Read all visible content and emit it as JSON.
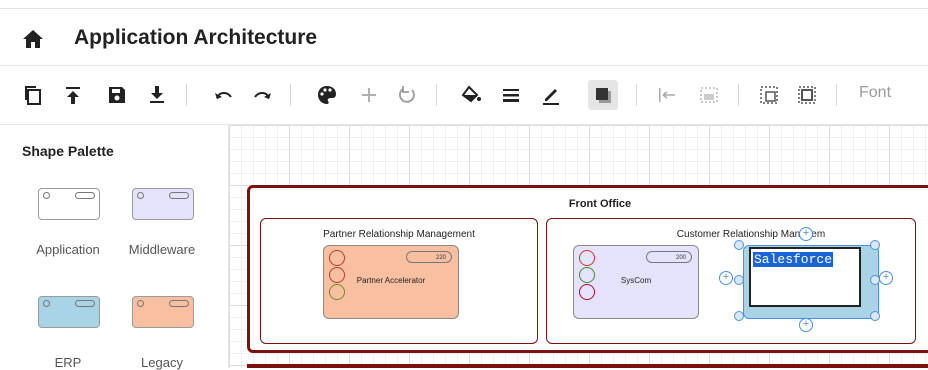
{
  "header": {
    "title": "Application Architecture"
  },
  "toolbar": {
    "font_label": "Font",
    "buttons": [
      "copy-icon",
      "bring-front-icon",
      "save-icon",
      "download-icon",
      "undo-icon",
      "redo-icon",
      "palette-icon",
      "add-icon",
      "reset-icon",
      "fill-icon",
      "line-style-icon",
      "pen-icon",
      "shadow-icon",
      "align-left-icon",
      "distribute-icon",
      "group-icon",
      "ungroup-icon"
    ]
  },
  "palette": {
    "title": "Shape Palette",
    "shapes": [
      {
        "label": "Application",
        "color": "#ffffff"
      },
      {
        "label": "Middleware",
        "color": "#e4e3fb"
      },
      {
        "label": "ERP",
        "color": "#a8d4e6"
      },
      {
        "label": "Legacy",
        "color": "#f8bfa1"
      }
    ]
  },
  "diagram": {
    "front_office": {
      "title": "Front Office",
      "prm": {
        "title": "Partner Relationship Management",
        "app": {
          "name": "Partner Accelerator",
          "id": "220",
          "color": "#f8bfa1"
        }
      },
      "crm": {
        "title": "Customer Relationship Managem",
        "app1": {
          "name": "SysCom",
          "id": "200",
          "color": "#e4e3fb"
        },
        "editor_text": "Salesforce"
      }
    },
    "border_color": "#7a1212",
    "selection_color": "#4a90e2"
  }
}
